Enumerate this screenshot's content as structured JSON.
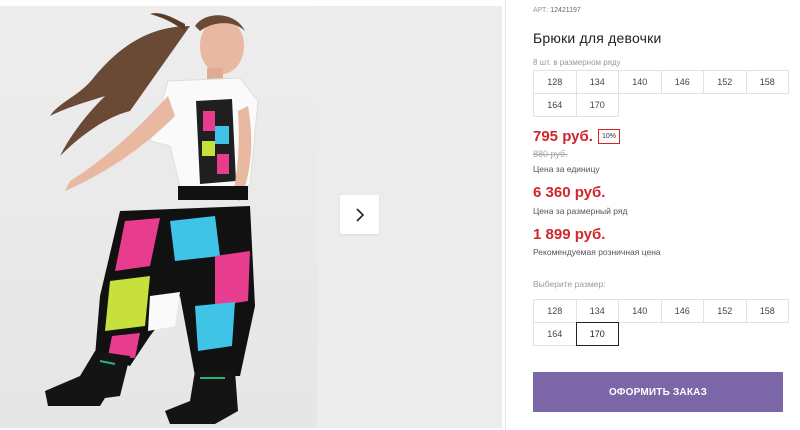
{
  "product": {
    "art_label": "АРТ:",
    "art_value": "12421197",
    "title": "Брюки для девочки",
    "pack_note": "8 шт. в размерном ряду",
    "pack_sizes": [
      "128",
      "134",
      "140",
      "146",
      "152",
      "158",
      "164",
      "170"
    ],
    "price": "795 руб.",
    "discount": "10%",
    "old_price": "880 руб.",
    "price_unit_label": "Цена за единицу",
    "pack_price": "6 360 руб.",
    "pack_price_label": "Цена за размерный ряд",
    "retail_price": "1 899 руб.",
    "retail_price_label": "Рекомендуемая розничная цена",
    "choose_size_label": "Выберите размер:",
    "pick_sizes": [
      "128",
      "134",
      "140",
      "146",
      "152",
      "158",
      "164",
      "170"
    ],
    "selected_size": "170",
    "order_button": "ОФОРМИТЬ ЗАКАЗ"
  },
  "colors": {
    "price_red": "#d0262c",
    "button_purple": "#7b66a8"
  },
  "icons": {
    "gallery_next": "chevron-right-icon"
  }
}
